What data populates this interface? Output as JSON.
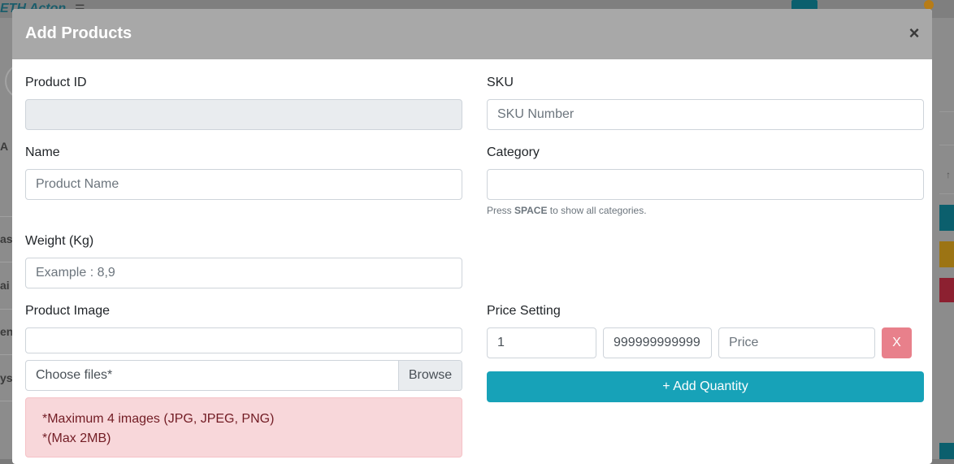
{
  "background": {
    "brand_text": "ETH Acton",
    "menu_icon": "hamburger-icon",
    "side_text_1": "A",
    "side_text_2": "as",
    "side_text_3": "ai",
    "side_text_4": "en",
    "side_text_5": "yst"
  },
  "modal": {
    "title": "Add Products",
    "close_symbol": "×"
  },
  "form": {
    "product_id": {
      "label": "Product ID",
      "value": ""
    },
    "sku": {
      "label": "SKU",
      "placeholder": "SKU Number"
    },
    "name": {
      "label": "Name",
      "placeholder": "Product Name"
    },
    "category": {
      "label": "Category",
      "value": "",
      "help_prefix": "Press ",
      "help_key": "SPACE",
      "help_suffix": " to show all categories."
    },
    "weight": {
      "label": "Weight (Kg)",
      "placeholder": "Example : 8,9"
    },
    "product_image": {
      "label": "Product Image",
      "text_value": "",
      "file_label": "Choose files*",
      "browse_label": "Browse",
      "alert_line1": "*Maximum 4 images (JPG, JPEG, PNG)",
      "alert_line2": "*(Max 2MB)"
    },
    "price_setting": {
      "label": "Price Setting",
      "min_qty": "1",
      "max_qty": "999999999999",
      "price_placeholder": "Price",
      "delete_label": "X",
      "add_quantity_label": "+ Add Quantity"
    }
  },
  "colors": {
    "header_bg": "#a8a8a8",
    "add_quantity_bg": "#17a2b8",
    "delete_bg": "#e8808b",
    "alert_bg": "#f8d7da",
    "alert_text": "#721c24"
  }
}
